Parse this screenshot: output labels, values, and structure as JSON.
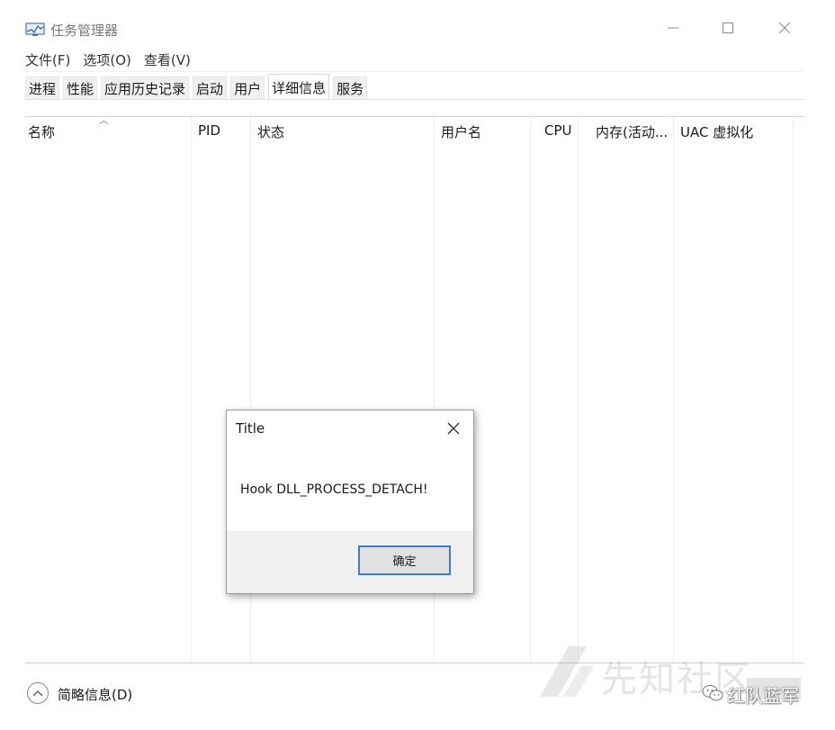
{
  "window": {
    "title": "任务管理器",
    "controls": {
      "minimize_icon": "minimize-icon",
      "maximize_icon": "maximize-icon",
      "close_icon": "close-icon"
    }
  },
  "menu": [
    "文件(F)",
    "选项(O)",
    "查看(V)"
  ],
  "tabs": [
    {
      "label": "进程",
      "active": false
    },
    {
      "label": "性能",
      "active": false
    },
    {
      "label": "应用历史记录",
      "active": false
    },
    {
      "label": "启动",
      "active": false
    },
    {
      "label": "用户",
      "active": false
    },
    {
      "label": "详细信息",
      "active": true
    },
    {
      "label": "服务",
      "active": false
    }
  ],
  "table": {
    "columns": [
      "名称",
      "PID",
      "状态",
      "用户名",
      "CPU",
      "内存(活动...",
      "UAC 虚拟化"
    ],
    "sorted_column": "名称",
    "rows": []
  },
  "footer": {
    "collapse_label": "简略信息(D)"
  },
  "dialog": {
    "title": "Title",
    "message": "Hook DLL_PROCESS_DETACH!",
    "ok_label": "确定",
    "accent_color": "#3c7ec9"
  },
  "watermarks": {
    "site": "先知社区",
    "wechat": "红队蓝军"
  }
}
